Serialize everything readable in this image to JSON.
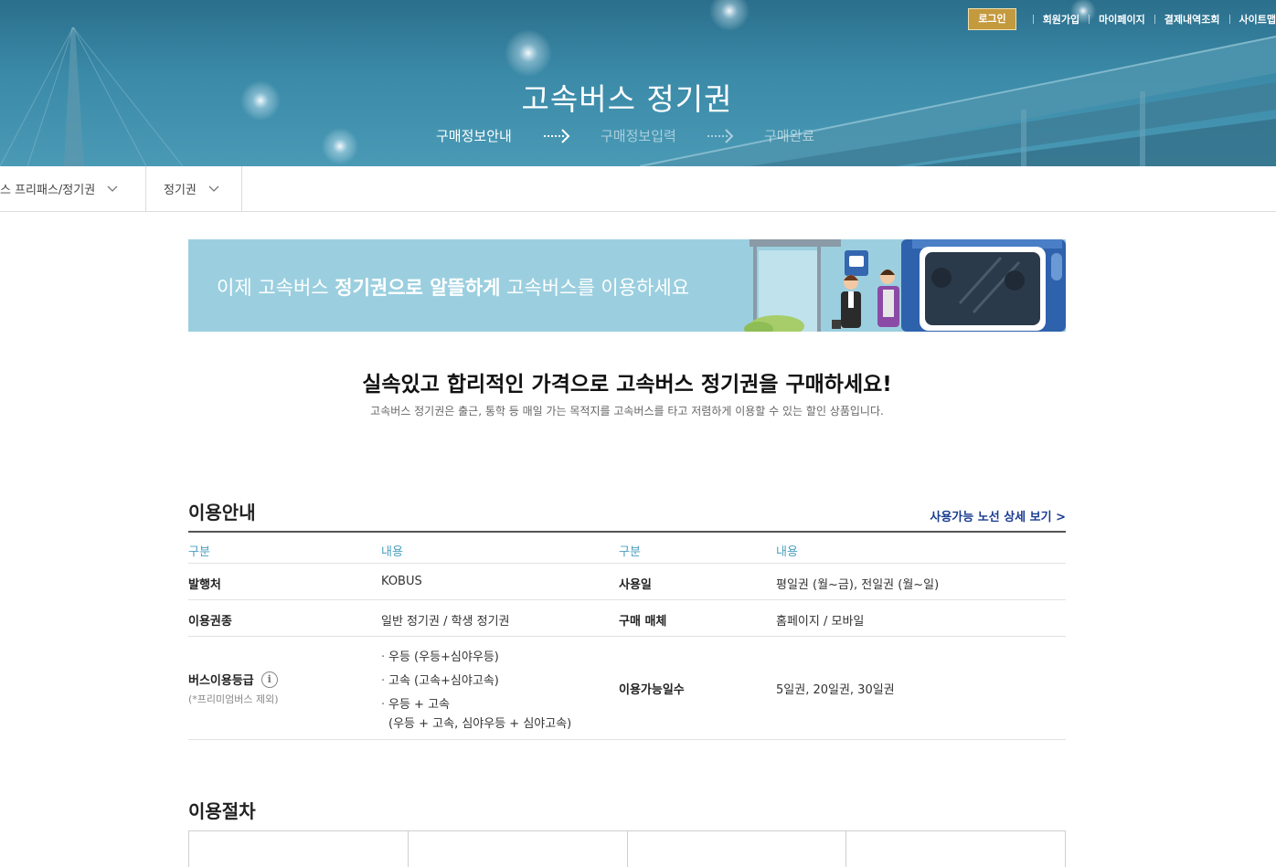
{
  "util_nav": {
    "login": "로그인",
    "join": "회원가입",
    "mypage": "마이페이지",
    "payment_history": "결제내역조회",
    "sitemap": "사이트맵"
  },
  "hero": {
    "title": "고속버스 정기권",
    "steps": [
      "구매정보안내",
      "구매정보입력",
      "구매완료"
    ],
    "active_step": 0
  },
  "location": {
    "crumb1": "스 프리패스/정기권",
    "crumb2": "정기권"
  },
  "banner": {
    "text_pre": "이제 고속버스 ",
    "text_bold": "정기권으로 알뜰하게",
    "text_post": " 고속버스를 이용하세요"
  },
  "intro": {
    "title": "실속있고 합리적인 가격으로 고속버스 정기권을 구매하세요!",
    "desc": "고속버스 정기권은 출근, 통학 등 매일 가는 목적지를 고속버스를 타고 저렴하게 이용할 수 있는 할인 상품입니다."
  },
  "guide": {
    "title": "이용안내",
    "detail_link": "사용가능 노선 상세 보기 >",
    "headers": [
      "구분",
      "내용",
      "구분",
      "내용"
    ],
    "rows": [
      {
        "k1": "발행처",
        "v1": "KOBUS",
        "k2": "사용일",
        "v2": "평일권 (월~금), 전일권 (월~일)"
      },
      {
        "k1": "이용권종",
        "v1": "일반 정기권 / 학생 정기권",
        "k2": "구매 매체",
        "v2": "홈페이지 / 모바일"
      }
    ],
    "grade": {
      "label": "버스이용등급",
      "info_icon": "i",
      "note": "(*프리미엄버스 제외)",
      "items": [
        "우등 (우등+심야우등)",
        "고속 (고속+심야고속)",
        "우등 + 고속"
      ],
      "item3_sub": "(우등 + 고속, 심야우등 + 심야고속)",
      "k2": "이용가능일수",
      "v2": "5일권, 20일권, 30일권"
    }
  },
  "procedure": {
    "title": "이용절차"
  },
  "colors": {
    "hero_top": "#2b6f8c",
    "login_bg": "#c39a3d",
    "banner_bg": "#9bcfdf",
    "table_head": "#4a9fbf",
    "link": "#1a3d8f"
  },
  "icons": [
    "chevron-down-icon",
    "step-arrow-icon",
    "info-icon"
  ]
}
